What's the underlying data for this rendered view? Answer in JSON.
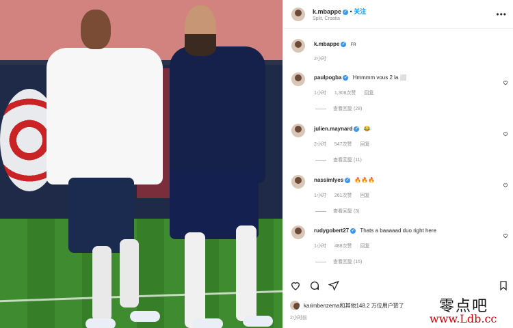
{
  "post": {
    "author": "k.mbappe",
    "location": "Split, Croatia",
    "follow_label": "关注",
    "more_label": "•••",
    "caption_author": "k.mbappe",
    "caption_text": "FR",
    "caption_time": "2小时"
  },
  "comments": [
    {
      "user": "paulpogba",
      "text": "Hmmmm vous 2 la ⬜",
      "time": "1小时",
      "likes": "1,308次赞",
      "reply": "回复",
      "view": "查看回复 (28)"
    },
    {
      "user": "julien.maynard",
      "text": "😂",
      "time": "2小时",
      "likes": "547次赞",
      "reply": "回复",
      "view": "查看回复 (11)"
    },
    {
      "user": "nassimlyes",
      "text": "🔥🔥🔥",
      "time": "1小时",
      "likes": "261次赞",
      "reply": "回复",
      "view": "查看回复 (3)"
    },
    {
      "user": "rudygobert27",
      "text": "Thats a baaaaad duo right here",
      "time": "1小时",
      "likes": "488次赞",
      "reply": "回复",
      "view": "查看回复 (15)"
    }
  ],
  "footer": {
    "likes_text": "karimbenzema和其他148.2 万位用户赞了",
    "time": "2小时前"
  },
  "watermark": {
    "line1": "零点吧",
    "line2": "www.Ldb.cc"
  },
  "colors": {
    "verified": "#3897f0",
    "link": "#0095f6",
    "watermark_red": "#d10000"
  }
}
